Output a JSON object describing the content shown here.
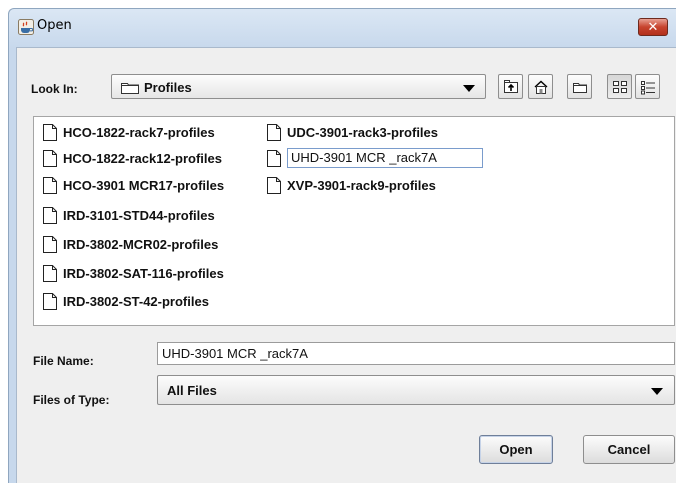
{
  "window": {
    "title": "Open",
    "close_label": "✕"
  },
  "look_in": {
    "label": "Look In:",
    "value": "Profiles"
  },
  "toolbar": {
    "buttons": [
      "up-one-level",
      "home",
      "new-folder",
      "list-view",
      "details-view"
    ]
  },
  "files": [
    {
      "name": "HCO-1822-rack7-profiles"
    },
    {
      "name": "HCO-1822-rack12-profiles"
    },
    {
      "name": "HCO-3901 MCR17-profiles"
    },
    {
      "name": "IRD-3101-STD44-profiles"
    },
    {
      "name": "IRD-3802-MCR02-profiles"
    },
    {
      "name": "IRD-3802-SAT-116-profiles"
    },
    {
      "name": "IRD-3802-ST-42-profiles"
    },
    {
      "name": "UDC-3901-rack3-profiles"
    },
    {
      "name": "UHD-3901 MCR _rack7A",
      "editing": true
    },
    {
      "name": "XVP-3901-rack9-profiles"
    }
  ],
  "file_name": {
    "label": "File Name:",
    "value": "UHD-3901 MCR _rack7A"
  },
  "files_of_type": {
    "label": "Files of Type:",
    "value": "All Files"
  },
  "actions": {
    "open_label": "Open",
    "cancel_label": "Cancel"
  }
}
